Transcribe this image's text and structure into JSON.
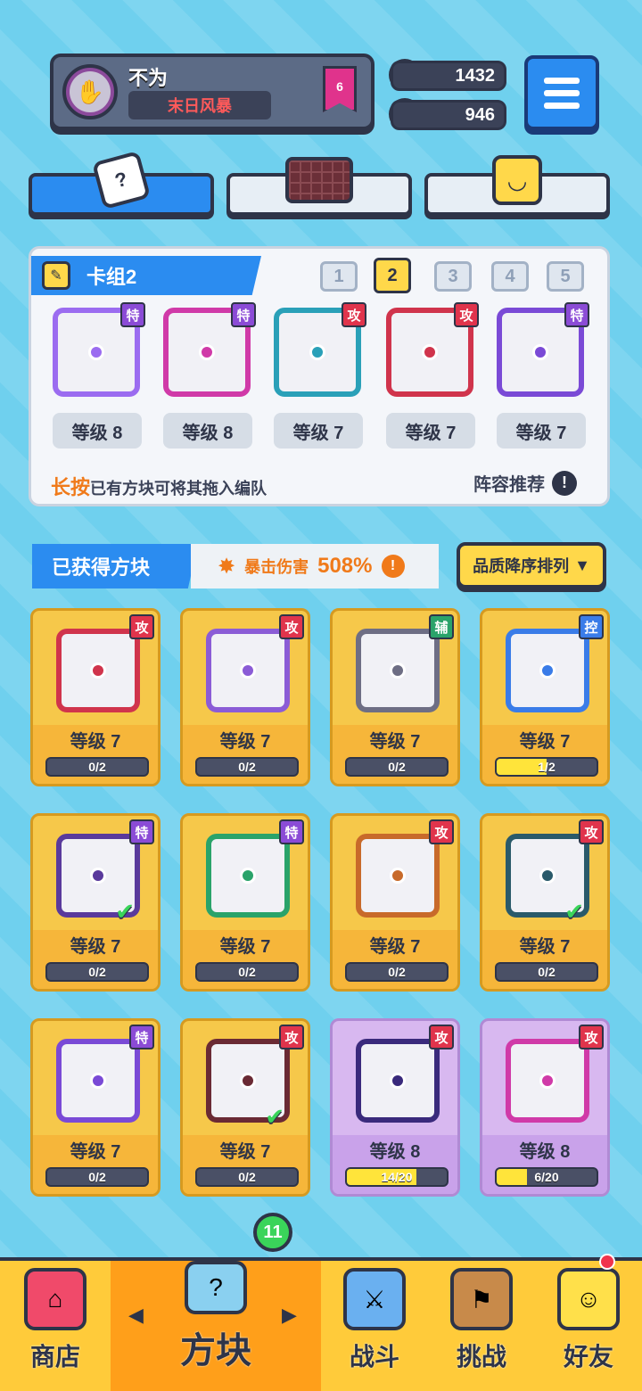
{
  "profile": {
    "name": "不为",
    "title": "末日风暴",
    "rank": "6"
  },
  "currency": {
    "gems": "1432",
    "coins": "946"
  },
  "top_tabs": [
    "dice-icon",
    "grid-icon",
    "smile-icon"
  ],
  "deck": {
    "name": "卡组2",
    "tabs": [
      "1",
      "2",
      "3",
      "4",
      "5"
    ],
    "selected_tab": "2",
    "cards": [
      {
        "tag": "特",
        "level": "等级 8",
        "color": "#9b6cf0"
      },
      {
        "tag": "特",
        "level": "等级 8",
        "color": "#d03aa8"
      },
      {
        "tag": "攻",
        "level": "等级 7",
        "color": "#2aa0b8"
      },
      {
        "tag": "攻",
        "level": "等级 7",
        "color": "#d0344c"
      },
      {
        "tag": "特",
        "level": "等级 7",
        "color": "#7a4ad6"
      }
    ],
    "hint_highlight": "长按",
    "hint_text": "已有方块可将其拖入编队",
    "recommend": "阵容推荐",
    "recommend_icon": "!"
  },
  "obtained": {
    "label": "已获得方块",
    "crit_label": "暴击伤害",
    "crit_value": "508%",
    "crit_icon": "!",
    "sort_label": "品质降序排列",
    "sort_arrow": "▼"
  },
  "inventory": [
    {
      "tag": "攻",
      "level": "等级 7",
      "progress": "0/2",
      "fill": 0,
      "color": "#d0344c",
      "card": "gold",
      "checked": false
    },
    {
      "tag": "攻",
      "level": "等级 7",
      "progress": "0/2",
      "fill": 0,
      "color": "#8b5cd6",
      "card": "gold",
      "checked": false
    },
    {
      "tag": "辅",
      "level": "等级 7",
      "progress": "0/2",
      "fill": 0,
      "color": "#6e6e84",
      "card": "gold",
      "checked": false
    },
    {
      "tag": "控",
      "level": "等级 7",
      "progress": "1/2",
      "fill": 0.5,
      "color": "#3a7ce8",
      "card": "gold",
      "checked": false
    },
    {
      "tag": "特",
      "level": "等级 7",
      "progress": "0/2",
      "fill": 0,
      "color": "#5a3a9c",
      "card": "gold",
      "checked": true
    },
    {
      "tag": "特",
      "level": "等级 7",
      "progress": "0/2",
      "fill": 0,
      "color": "#2aa36a",
      "card": "gold",
      "checked": false
    },
    {
      "tag": "攻",
      "level": "等级 7",
      "progress": "0/2",
      "fill": 0,
      "color": "#c86a2a",
      "card": "gold",
      "checked": false
    },
    {
      "tag": "攻",
      "level": "等级 7",
      "progress": "0/2",
      "fill": 0,
      "color": "#2a5a6a",
      "card": "gold",
      "checked": true
    },
    {
      "tag": "特",
      "level": "等级 7",
      "progress": "0/2",
      "fill": 0,
      "color": "#7a4ad6",
      "card": "gold",
      "checked": false
    },
    {
      "tag": "攻",
      "level": "等级 7",
      "progress": "0/2",
      "fill": 0,
      "color": "#6a2a34",
      "card": "gold",
      "checked": true
    },
    {
      "tag": "攻",
      "level": "等级 8",
      "progress": "14/20",
      "fill": 0.7,
      "color": "#3a2a7c",
      "card": "purple",
      "checked": false
    },
    {
      "tag": "攻",
      "level": "等级 8",
      "progress": "6/20",
      "fill": 0.3,
      "color": "#d03aa8",
      "card": "purple",
      "checked": false
    }
  ],
  "bottom_nav": [
    {
      "label": "商店",
      "icon": "shop-icon"
    },
    {
      "label": "方块",
      "icon": "block-icon"
    },
    {
      "label": "战斗",
      "icon": "battle-icon"
    },
    {
      "label": "挑战",
      "icon": "challenge-icon"
    },
    {
      "label": "好友",
      "icon": "friends-icon"
    }
  ],
  "block_badge": "11",
  "nav_arrows": {
    "left": "◀",
    "right": "▶"
  }
}
